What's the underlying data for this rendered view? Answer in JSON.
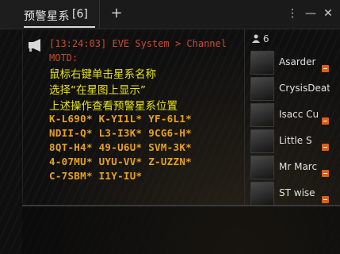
{
  "window": {
    "tab_title": "预警星系",
    "tab_count": "[6]",
    "add_tab_symbol": "+",
    "menu_symbol": "⋮",
    "minimize_symbol": "—",
    "close_symbol": "✕"
  },
  "chat": {
    "header": "[13:24:03] EVE System > Channel",
    "motd_label": "MOTD:",
    "instructions": [
      "鼠标右键单击星系名称",
      "选择“在星图上显示”",
      "上述操作查看预警星系位置"
    ],
    "system_rows": [
      "K-L690*  K-YI1L*  YF-6L1*",
      "NDII-Q*  L3-I3K*  9CG6-H*",
      "8QT-H4*  49-U6U*  SVM-3K*",
      "4-07MU*  UYU-VV*  Z-UZZN*",
      "C-7SBM*  I1Y-IU*"
    ]
  },
  "members": {
    "count": "6",
    "list": [
      {
        "name": "Asarder"
      },
      {
        "name": "CrysisDeat"
      },
      {
        "name": "Isacc Cu"
      },
      {
        "name": "Little S"
      },
      {
        "name": "Mr Marc"
      },
      {
        "name": "ST wise"
      }
    ]
  },
  "colors": {
    "header_red": "#c84b2d",
    "instruction_yellow": "#e9e217",
    "system_orange": "#e8a21a",
    "standing_orange": "#d7601c"
  }
}
